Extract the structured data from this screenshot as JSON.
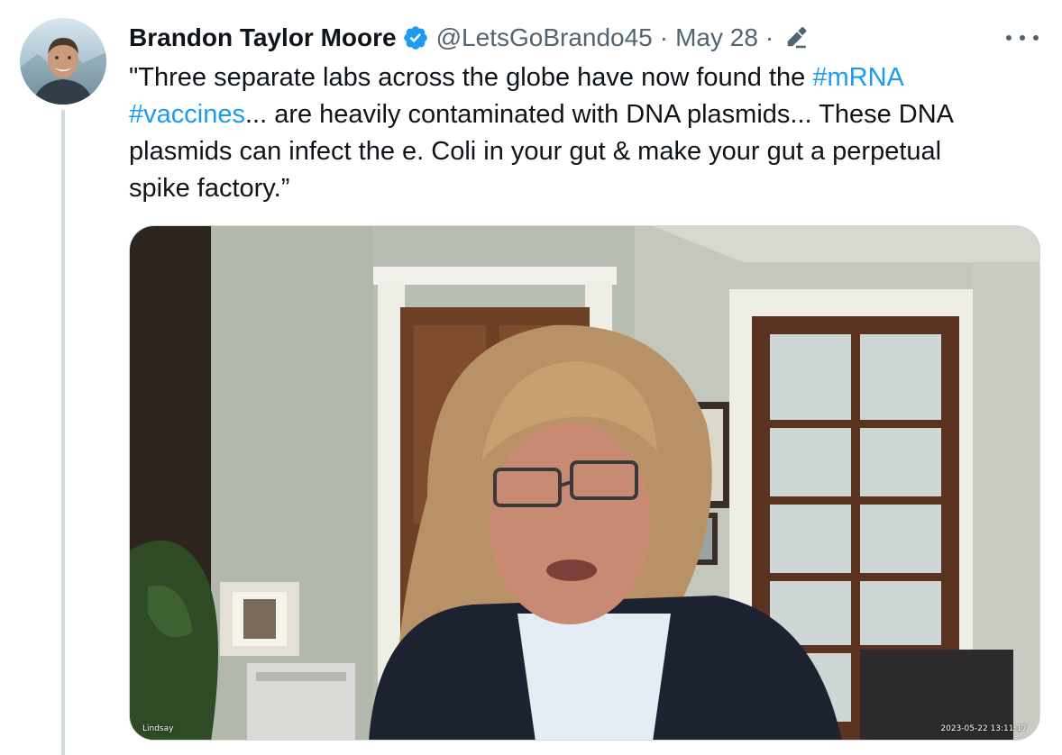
{
  "tweet": {
    "author": {
      "display_name": "Brandon Taylor Moore",
      "handle": "@LetsGoBrando45",
      "verified": true
    },
    "date": "May 28",
    "edited": true,
    "text_lines": [
      [
        {
          "t": "\"Three separate labs across the globe have now found the ",
          "tag": false
        },
        {
          "t": "#mRNA",
          "tag": true
        }
      ],
      [
        {
          "t": "#vaccines",
          "tag": true
        },
        {
          "t": "... are heavily contaminated with DNA plasmids... These DNA",
          "tag": false
        }
      ],
      [
        {
          "t": "plasmids can infect the e. Coli in your gut & make your gut a perpetual",
          "tag": false
        }
      ],
      [
        {
          "t": "spike factory.”",
          "tag": false
        }
      ]
    ],
    "media": {
      "caption_name": "Lindsay",
      "caption_timestamp": "2023-05-22 13:11:17"
    }
  },
  "icons": {
    "verified": "verified-badge-icon",
    "edit": "pencil-edit-icon",
    "more": "more-options-icon"
  },
  "colors": {
    "text": "#0f1419",
    "secondary": "#536471",
    "link": "#1d9bf0",
    "verified": "#1d9bf0",
    "border": "#cfd9de"
  }
}
